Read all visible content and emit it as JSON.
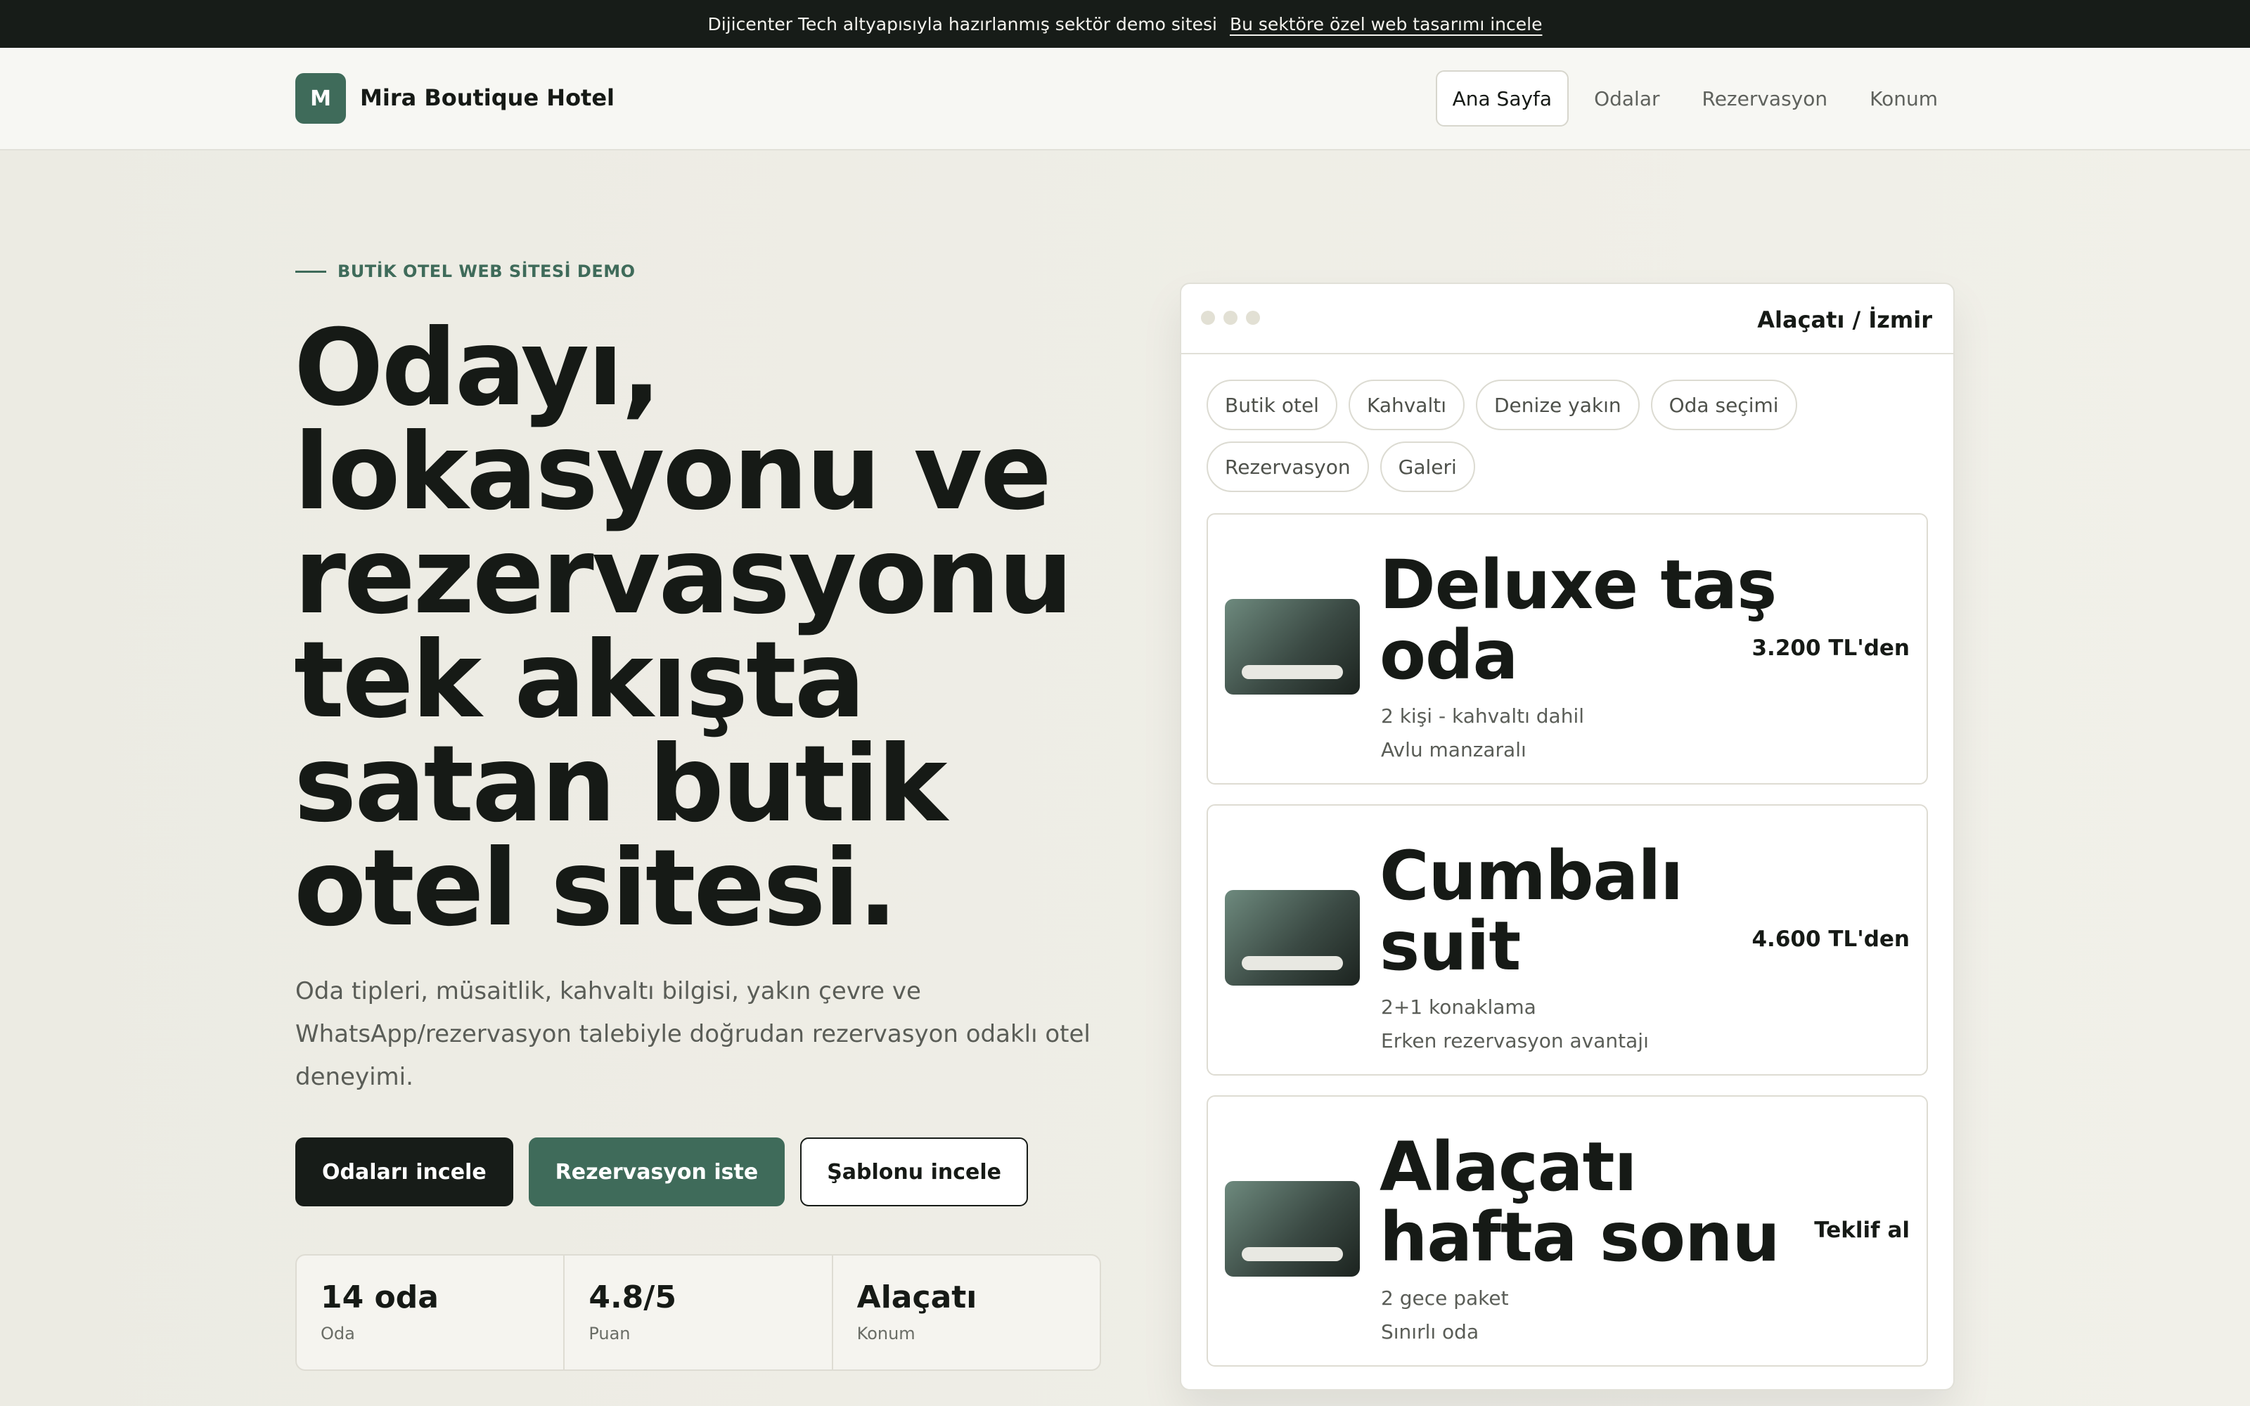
{
  "topbar": {
    "text": "Dijicenter Tech altyapısıyla hazırlanmış sektör demo sitesi",
    "link": "Bu sektöre özel web tasarımı incele"
  },
  "header": {
    "logo_letter": "M",
    "brand": "Mira Boutique Hotel",
    "nav": [
      {
        "label": "Ana Sayfa",
        "active": true
      },
      {
        "label": "Odalar"
      },
      {
        "label": "Rezervasyon"
      },
      {
        "label": "Konum"
      }
    ]
  },
  "hero": {
    "eyebrow": "BUTİK OTEL WEB SİTESİ DEMO",
    "headline": [
      "Odayı,",
      "lokasyonu ve",
      "rezervasyonu",
      "tek akışta",
      "satan butik",
      "otel sitesi."
    ],
    "lead": "Oda tipleri, müsaitlik, kahvaltı bilgisi, yakın çevre ve WhatsApp/rezervasyon talebiyle doğrudan rezervasyon odaklı otel deneyimi.",
    "buttons": {
      "primary": "Odaları incele",
      "secondary": "Rezervasyon iste",
      "tertiary": "Şablonu incele"
    },
    "stats": [
      {
        "value": "14 oda",
        "label": "Oda"
      },
      {
        "value": "4.8/5",
        "label": "Puan"
      },
      {
        "value": "Alaçatı",
        "label": "Konum"
      }
    ]
  },
  "preview": {
    "title": "Alaçatı / İzmir",
    "chips": [
      "Butik otel",
      "Kahvaltı",
      "Denize yakın",
      "Oda seçimi",
      "Rezervasyon",
      "Galeri"
    ],
    "rooms": [
      {
        "name": "Deluxe taş oda",
        "meta1": "2 kişi - kahvaltı dahil",
        "meta2": "Avlu manzaralı",
        "price": "3.200 TL'den"
      },
      {
        "name": "Cumbalı suit",
        "meta1": "2+1 konaklama",
        "meta2": "Erken rezervasyon avantajı",
        "price": "4.600 TL'den"
      },
      {
        "name": "Alaçatı hafta sonu",
        "meta1": "2 gece paket",
        "meta2": "Sınırlı oda",
        "price": "Teklif al"
      }
    ]
  },
  "colors": {
    "accent": "#3f6b5a",
    "dark": "#171c18",
    "background": "#f0efe8"
  }
}
